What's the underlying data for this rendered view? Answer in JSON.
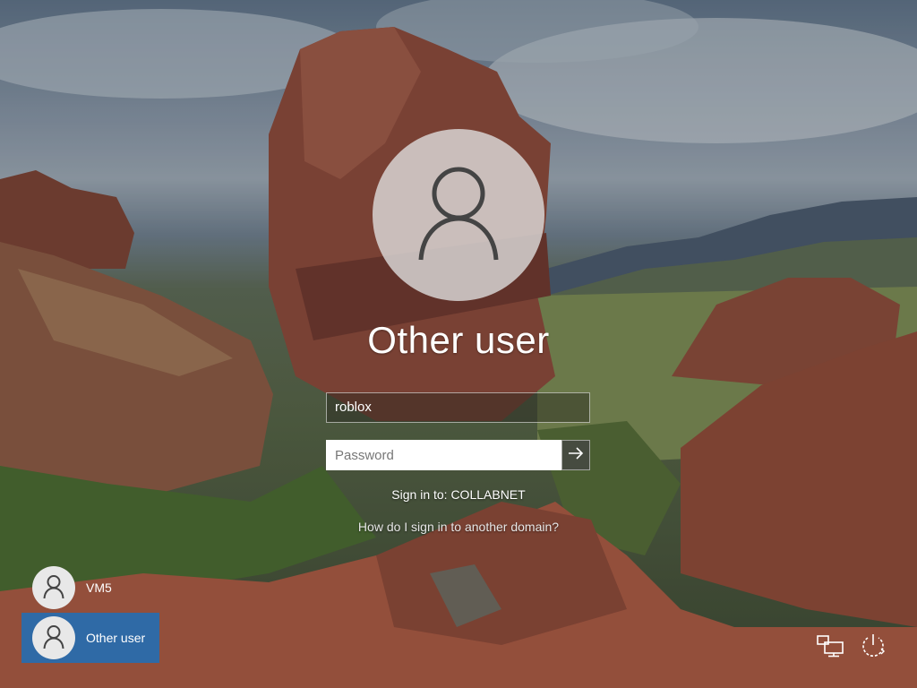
{
  "login": {
    "title": "Other user",
    "username_value": "roblox",
    "password_placeholder": "Password",
    "signin_to": "Sign in to: COLLABNET",
    "help_link": "How do I sign in to another domain?"
  },
  "user_list": [
    {
      "name": "VM5",
      "selected": false
    },
    {
      "name": "Other user",
      "selected": true
    }
  ],
  "icons": {
    "avatar": "user-silhouette-icon",
    "submit": "arrow-right-icon",
    "network": "network-icon",
    "power": "power-icon"
  },
  "colors": {
    "selected_tile": "#2f6aa6"
  }
}
